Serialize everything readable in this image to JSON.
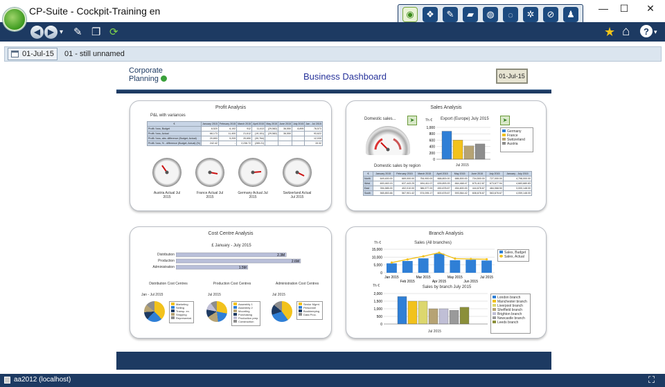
{
  "window": {
    "title": "CP-Suite - Cockpit-Training en",
    "minimize": "—",
    "maximize": "☐",
    "close": "✕"
  },
  "modules": [
    {
      "name": "cockpit",
      "icon": "◉"
    },
    {
      "name": "group",
      "icon": "❖"
    },
    {
      "name": "plan",
      "icon": "✎"
    },
    {
      "name": "money",
      "icon": "▰"
    },
    {
      "name": "globe",
      "icon": "◍"
    },
    {
      "name": "cycle",
      "icon": "◌"
    },
    {
      "name": "settings",
      "icon": "✲"
    },
    {
      "name": "compass",
      "icon": "⊘"
    },
    {
      "name": "people",
      "icon": "♟"
    }
  ],
  "toolbar": {
    "back": "◀",
    "forward": "▶",
    "dropdown": "▾",
    "pen": "✎",
    "copy": "❐",
    "refresh": "⟳",
    "star": "★",
    "home": "⌂",
    "help": "?"
  },
  "datebar": {
    "date": "01-Jul-15",
    "scenario": "01 - still unnamed"
  },
  "dashboard": {
    "logo_line1": "Corporate",
    "logo_line2": "Planning",
    "title": "Business Dashboard",
    "date": "01-Jul-15"
  },
  "profit": {
    "title": "Profit Analysis",
    "subtitle": "P&L with variances",
    "unit": "€",
    "columns": [
      "January 2015",
      "February 2015",
      "March 2015",
      "April 2015",
      "May 2015",
      "June 2015",
      "July 2015",
      "Jan - Jul 2015"
    ],
    "rows": [
      {
        "label": "Profit / loss, Budget",
        "values": [
          "8,520",
          "6,192",
          "912",
          "11,613",
          "(29,582)",
          "36,550",
          "8,895",
          "78,573"
        ]
      },
      {
        "label": "Profit / loss, Actual",
        "values": [
          "68,173",
          "11,400",
          "21,612",
          "(19,151)",
          "(29,582)",
          "36,550",
          "",
          "93,622"
        ]
      },
      {
        "label": "Profit / loss, abs. difference (Budget, Actual)",
        "values": [
          "20,653",
          "5,209",
          "20,650",
          "(30,764)",
          "",
          "",
          "",
          "12,039"
        ]
      },
      {
        "label": "Profit / loss, % - difference (Budget, Actual) (%)",
        "values": [
          "242.42",
          "-",
          "2,236.72",
          "(265.21)",
          "",
          "",
          "",
          "15.32"
        ]
      }
    ],
    "gauges": [
      {
        "line1": "Austria Actual Jul",
        "line2": "2015"
      },
      {
        "line1": "France Actual Jul",
        "line2": "2015"
      },
      {
        "line1": "Germany Actual Jul",
        "line2": "2015"
      },
      {
        "line1": "Switzerland Actual",
        "line2": "Jul 2015"
      }
    ]
  },
  "sales": {
    "title": "Sales Analysis",
    "domestic_label": "Domestic sales...",
    "th_label": "Th €",
    "export_title": "Export (Europe) July 2015",
    "export_xlabel": "Jul 2015",
    "domestic_region_title": "Domestic sales by region",
    "table_columns": [
      "January 2015",
      "February 2015",
      "March 2015",
      "April 2015",
      "May 2015",
      "June 2015",
      "July 2015",
      "January - July 2015"
    ],
    "table_rows": [
      {
        "label": "North",
        "values": [
          "649,400.00",
          "669,000.00",
          "754,900.00",
          "668,800.00",
          "686,500.00",
          "704,500.00",
          "727,000.00",
          "4,798,000.00"
        ]
      },
      {
        "label": "West",
        "values": [
          "600,463.15",
          "637,443.25",
          "694,411.07",
          "639,893.93",
          "664,468.47",
          "675,412.87",
          "673,677.94",
          "4,683,680.83"
        ]
      },
      {
        "label": "East",
        "values": [
          "394,585.00",
          "402,010.00",
          "386,577.00",
          "450,678.67",
          "454,600.00",
          "444,678.67",
          "484,068.50",
          "3,000,148.00"
        ]
      },
      {
        "label": "South",
        "values": [
          "565,853.66",
          "567,901.42",
          "574,095.17",
          "600,678.67",
          "593,564.42",
          "608,678.67",
          "563,678.67",
          "4,059,148.00"
        ]
      }
    ]
  },
  "cost": {
    "title": "Cost Centre Analysis",
    "subtitle": "£ January - July 2015",
    "bars": [
      {
        "label": "Distribution",
        "value": "2.3M"
      },
      {
        "label": "Production",
        "value": "2.6M"
      },
      {
        "label": "Administration",
        "value": "1.5M"
      }
    ],
    "pies": [
      {
        "title": "Distribution Cost Centres",
        "period": "Jan - Jul 2015",
        "legend": [
          "Marketing",
          "Selling",
          "Transp. ex.",
          "Shipping",
          "Representat."
        ]
      },
      {
        "title": "Production Cost Centres",
        "period": "Jul 2015",
        "legend": [
          "Assembly 1",
          "Assembly 2",
          "Mounting",
          "Purchasing",
          "Production prep.",
          "Construction"
        ]
      },
      {
        "title": "Administration Cost Centres",
        "period": "Jul 2015",
        "legend": [
          "Senior Mgmt.",
          "Personnel",
          "Bookkeeping",
          "Data Proc."
        ]
      }
    ]
  },
  "branch": {
    "title": "Branch Analysis",
    "sales_title": "Sales (All branches)",
    "sales_unit": "Th €",
    "legend": [
      "Sales, Budget",
      "Sales, Actual"
    ],
    "bottom_title": "Sales by branch July 2015",
    "bottom_unit": "Th €",
    "bottom_xlabel": "Jul 2015",
    "bottom_legend": [
      "London branch",
      "Manchester branch",
      "Liverpool branch",
      "Sheffield branch",
      "Brighton branch",
      "Newcastle branch",
      "Leeds branch"
    ]
  },
  "statusbar": {
    "server": "aa2012 (localhost)",
    "fullscreen": "⛶"
  },
  "chart_data": [
    {
      "type": "bar",
      "title": "Export (Europe) July 2015",
      "categories": [
        "Jul 2015"
      ],
      "ylabel": "Th €",
      "ylim": [
        0,
        1000
      ],
      "series": [
        {
          "name": "Germany",
          "values": [
            880
          ]
        },
        {
          "name": "France",
          "values": [
            600
          ]
        },
        {
          "name": "Switzerland",
          "values": [
            420
          ]
        },
        {
          "name": "Austria",
          "values": [
            480
          ]
        }
      ],
      "colors": [
        "#2f7fd6",
        "#f2c21c",
        "#b6a374",
        "#8d8d8d"
      ]
    },
    {
      "type": "line",
      "title": "Sales (All branches)",
      "ylabel": "Th €",
      "ylim": [
        0,
        15000
      ],
      "x": [
        "Jan 2015",
        "Feb 2015",
        "Mar 2015",
        "Apr 2015",
        "May 2015",
        "Jun 2015",
        "Jul 2015"
      ],
      "series": [
        {
          "name": "Sales, Budget",
          "values": [
            6000,
            7500,
            9200,
            12200,
            8000,
            8300,
            7800
          ]
        },
        {
          "name": "Sales, Actual",
          "values": [
            6500,
            8500,
            10500,
            12800,
            9000,
            8800,
            8600
          ]
        }
      ],
      "colors": [
        "#2f7fd6",
        "#f2c21c"
      ]
    },
    {
      "type": "bar",
      "title": "Sales by branch July 2015",
      "categories": [
        "Jul 2015"
      ],
      "ylabel": "Th €",
      "ylim": [
        0,
        2000
      ],
      "series": [
        {
          "name": "London branch",
          "values": [
            1800
          ]
        },
        {
          "name": "Manchester branch",
          "values": [
            1500
          ]
        },
        {
          "name": "Liverpool branch",
          "values": [
            1500
          ]
        },
        {
          "name": "Sheffield branch",
          "values": [
            1000
          ]
        },
        {
          "name": "Brighton branch",
          "values": [
            1000
          ]
        },
        {
          "name": "Newcastle branch",
          "values": [
            900
          ]
        },
        {
          "name": "Leeds branch",
          "values": [
            1100
          ]
        }
      ],
      "colors": [
        "#2f7fd6",
        "#f2c21c",
        "#dcd76e",
        "#b6a374",
        "#c0bfd6",
        "#9a9a9a",
        "#8b8f3a"
      ]
    },
    {
      "type": "bar",
      "title": "£ January - July 2015",
      "categories": [
        "Distribution",
        "Production",
        "Administration"
      ],
      "values": [
        2.3,
        2.6,
        1.5
      ],
      "ylim": [
        0,
        2.6
      ],
      "colors": [
        "#b9bfd9"
      ]
    }
  ]
}
